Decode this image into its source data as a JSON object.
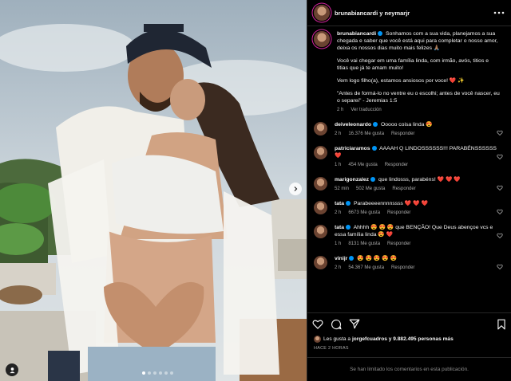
{
  "post": {
    "photo_alt": "Couple photo",
    "carousel": {
      "count": 6,
      "active": 0
    }
  },
  "header": {
    "author": "brunabiancardi",
    "connector": "y",
    "collaborator": "neymarjr",
    "names_text": "brunabiancardi y neymarjr"
  },
  "caption": {
    "user": "brunabiancardi",
    "paragraphs": [
      "Sonhamos com a sua vida, planejamos a sua chegada e saber que você está aqui para completar o nosso amor, deixa os nossos dias muito mais felizes 🙏🏽",
      "Você vai chegar em uma família linda, com irmão, avós, titios e titias que já te amam muito!",
      "Vem logo filho(a), estamos ansiosos por voce! ❤️ ✨",
      "\"Antes de formá-lo no ventre eu o escolhi; antes de você nascer, eu o separei\" - Jeremias 1:5"
    ],
    "time": "2 h",
    "translate": "Ver traducción"
  },
  "comments": [
    {
      "user": "deiveleonardo",
      "verified": true,
      "text": "Ooooo coisa linda 😍",
      "time": "2 h",
      "likes": "16.376 Me gusta",
      "reply": "Responder"
    },
    {
      "user": "patriciaramos",
      "verified": true,
      "text": "AAAAH Q LINDOSSSSSS!!! PARABÉNSSSSSS ❤️",
      "time": "1 h",
      "likes": "454 Me gusta",
      "reply": "Responder"
    },
    {
      "user": "marigonzalez",
      "verified": true,
      "text": "que lindosss, parabéns! ❤️ ❤️ ❤️",
      "time": "52 min",
      "likes": "502 Me gusta",
      "reply": "Responder"
    },
    {
      "user": "tata",
      "verified": true,
      "text": "Parabeeeennnnssss ❤️ ❤️ ❤️",
      "time": "2 h",
      "likes": "6673 Me gusta",
      "reply": "Responder"
    },
    {
      "user": "tata",
      "verified": true,
      "text": "Ahhhh 😍 😍 😍 que BENÇÃO! Que Deus abençoe vcs e essa família linda 😍 ❤️",
      "time": "1 h",
      "likes": "8131 Me gusta",
      "reply": "Responder"
    },
    {
      "user": "vinijr",
      "verified": true,
      "text": "😍 😍 😍 😍 😍",
      "time": "2 h",
      "likes": "54.367 Me gusta",
      "reply": "Responder"
    }
  ],
  "likes_line": {
    "prefix": "Les gusta a",
    "user": "jorgefcuadros",
    "suffix": "y 9.882.495 personas más"
  },
  "posted_age": "HACE 2 HORAS",
  "comments_limited": "Se han limitado los comentarios en esta publicación.",
  "icons": {
    "more": "more-horizontal-icon",
    "like": "heart-icon",
    "comment": "comment-icon",
    "share": "send-icon",
    "save": "bookmark-icon",
    "tag": "user-tag-icon",
    "next": "chevron-right-icon"
  },
  "colors": {
    "accent": "#0095f6",
    "heart": "#ff3040",
    "muted": "#a8a8a8",
    "background": "#000000"
  }
}
